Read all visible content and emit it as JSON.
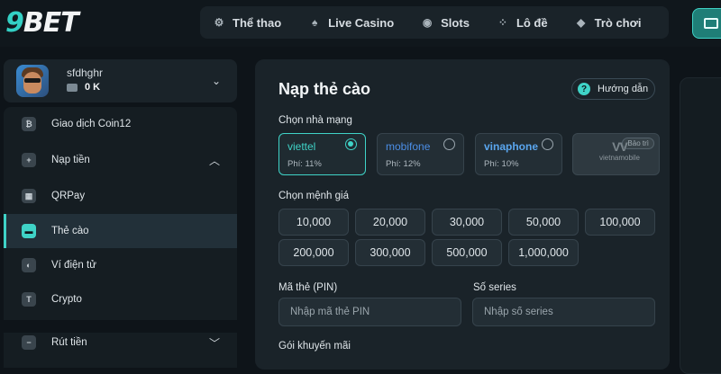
{
  "logo": {
    "prefix": "9",
    "rest": "BET"
  },
  "nav": [
    {
      "label": "Thể thao",
      "icon": "sports-icon",
      "glyph": "⚙"
    },
    {
      "label": "Live Casino",
      "icon": "casino-icon",
      "glyph": "♠"
    },
    {
      "label": "Slots",
      "icon": "slots-icon",
      "glyph": "◉"
    },
    {
      "label": "Lô đề",
      "icon": "lottery-icon",
      "glyph": "⁘"
    },
    {
      "label": "Trò chơi",
      "icon": "games-icon",
      "glyph": "◆"
    }
  ],
  "profile": {
    "username": "sfdhghr",
    "balance": "0 K"
  },
  "menu": [
    {
      "label": "Giao dịch Coin12",
      "icon": "coin-icon",
      "glyph": "₿"
    },
    {
      "label": "Nạp tiền",
      "icon": "deposit-icon",
      "glyph": "+"
    },
    {
      "label": "QRPay",
      "icon": "qr-icon",
      "glyph": "▦"
    },
    {
      "label": "Thẻ cào",
      "icon": "card-icon",
      "glyph": "▬"
    },
    {
      "label": "Ví điện tử",
      "icon": "ewallet-icon",
      "glyph": "◐"
    },
    {
      "label": "Crypto",
      "icon": "crypto-icon",
      "glyph": "T"
    },
    {
      "label": "Rút tiền",
      "icon": "withdraw-icon",
      "glyph": "−"
    }
  ],
  "panel": {
    "title": "Nạp thẻ cào",
    "guide_label": "Hướng dẫn",
    "carrier_label": "Chọn nhà mạng",
    "carriers": [
      {
        "name": "viettel",
        "fee": "Phí: 11%",
        "color": "#3fd3c7",
        "selected": true
      },
      {
        "name": "mobifone",
        "fee": "Phí: 12%",
        "color": "#4b8ee6",
        "selected": false
      },
      {
        "name": "vinaphone",
        "fee": "Phí: 10%",
        "color": "#5aa6ef",
        "selected": false
      },
      {
        "name": "vietnamobile",
        "maintenance": "Bảo trì",
        "disabled": true
      }
    ],
    "amount_label": "Chọn mệnh giá",
    "amounts": [
      "10,000",
      "20,000",
      "30,000",
      "50,000",
      "100,000",
      "200,000",
      "300,000",
      "500,000",
      "1,000,000"
    ],
    "pin_label": "Mã thẻ (PIN)",
    "pin_placeholder": "Nhập mã thẻ PIN",
    "serial_label": "Số series",
    "serial_placeholder": "Nhập số series",
    "promo_label": "Gói khuyến mãi"
  }
}
